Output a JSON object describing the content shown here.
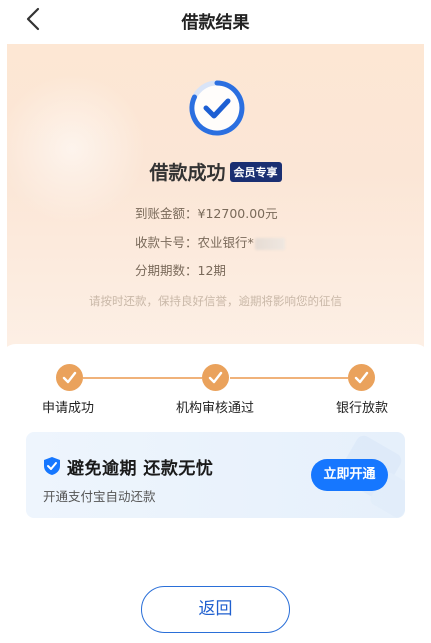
{
  "nav": {
    "title": "借款结果",
    "back_icon": "chevron-left-icon"
  },
  "hero": {
    "status_icon": "check-circle-icon",
    "status_text": "借款成功",
    "badge": "会员专享",
    "info": [
      {
        "label": "到账金额：",
        "value": "¥12700.00元"
      },
      {
        "label": "收款卡号：",
        "value": "农业银行*"
      },
      {
        "label": "分期期数：",
        "value": "12期"
      }
    ],
    "hint": "请按时还款，保持良好信誉，逾期将影响您的征信"
  },
  "steps": [
    {
      "label": "申请成功",
      "done": true
    },
    {
      "label": "机构审核通过",
      "done": true
    },
    {
      "label": "银行放款",
      "done": true
    }
  ],
  "promo": {
    "icon": "shield-check-icon",
    "title": "避免逾期 还款无忧",
    "subtitle": "开通支付宝自动还款",
    "button": "立即开通"
  },
  "footer": {
    "return_label": "返回"
  },
  "colors": {
    "accent_orange": "#eaa25c",
    "primary_blue": "#1677ff",
    "badge_navy": "#1a2f72"
  }
}
